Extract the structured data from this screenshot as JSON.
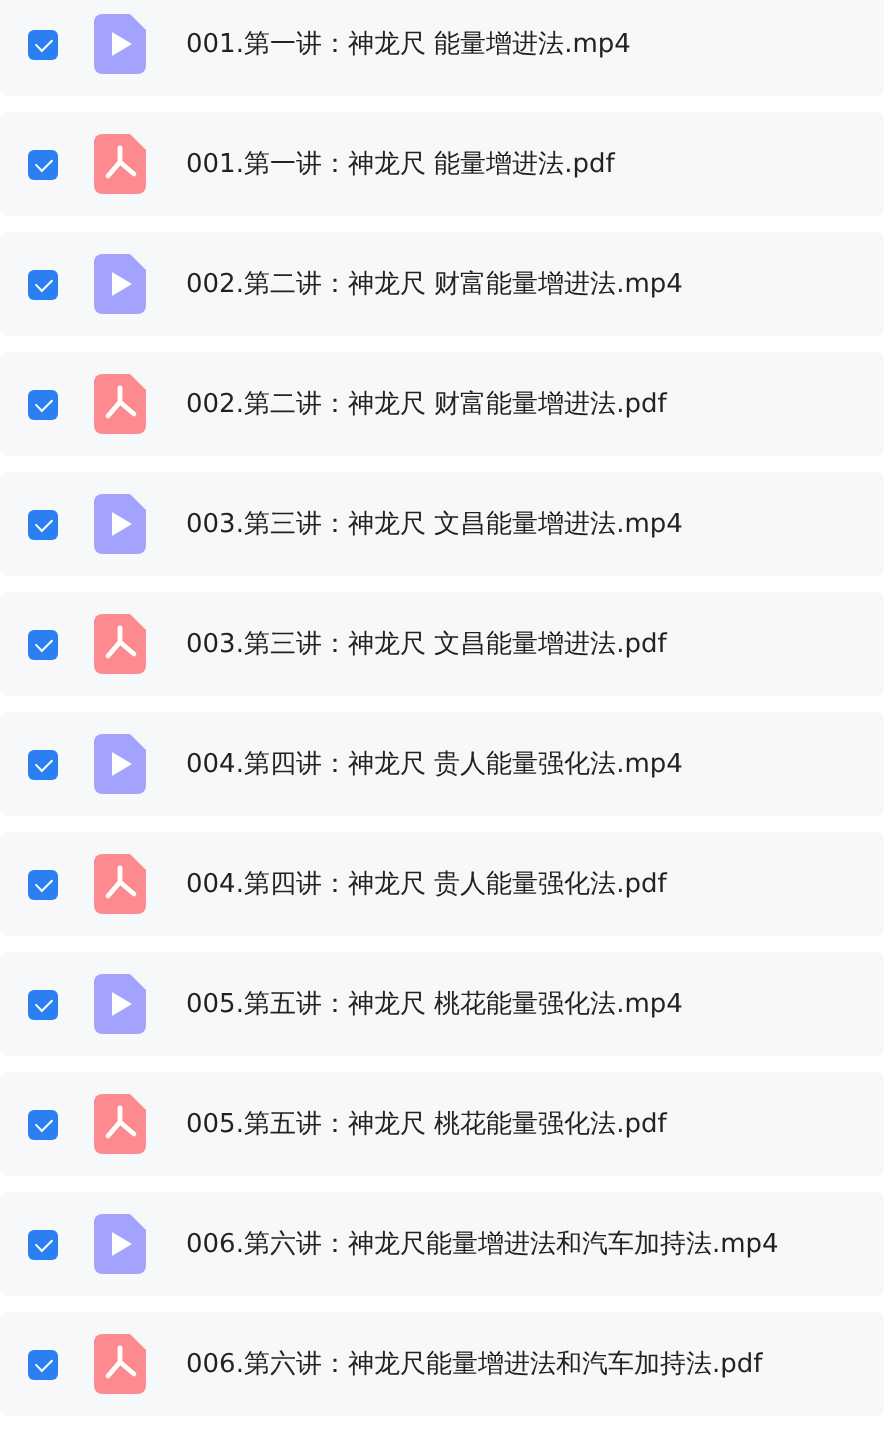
{
  "files": [
    {
      "name": "001.第一讲：神龙尺 能量增进法.mp4",
      "kind": "video",
      "checked": true
    },
    {
      "name": "001.第一讲：神龙尺 能量增进法.pdf",
      "kind": "pdf",
      "checked": true
    },
    {
      "name": "002.第二讲：神龙尺 财富能量增进法.mp4",
      "kind": "video",
      "checked": true
    },
    {
      "name": "002.第二讲：神龙尺 财富能量增进法.pdf",
      "kind": "pdf",
      "checked": true
    },
    {
      "name": "003.第三讲：神龙尺 文昌能量增进法.mp4",
      "kind": "video",
      "checked": true
    },
    {
      "name": "003.第三讲：神龙尺 文昌能量增进法.pdf",
      "kind": "pdf",
      "checked": true
    },
    {
      "name": "004.第四讲：神龙尺 贵人能量强化法.mp4",
      "kind": "video",
      "checked": true
    },
    {
      "name": "004.第四讲：神龙尺 贵人能量强化法.pdf",
      "kind": "pdf",
      "checked": true
    },
    {
      "name": "005.第五讲：神龙尺 桃花能量强化法.mp4",
      "kind": "video",
      "checked": true
    },
    {
      "name": "005.第五讲：神龙尺 桃花能量强化法.pdf",
      "kind": "pdf",
      "checked": true
    },
    {
      "name": "006.第六讲：神龙尺能量增进法和汽车加持法.mp4",
      "kind": "video",
      "checked": true
    },
    {
      "name": "006.第六讲：神龙尺能量增进法和汽车加持法.pdf",
      "kind": "pdf",
      "checked": true
    }
  ]
}
